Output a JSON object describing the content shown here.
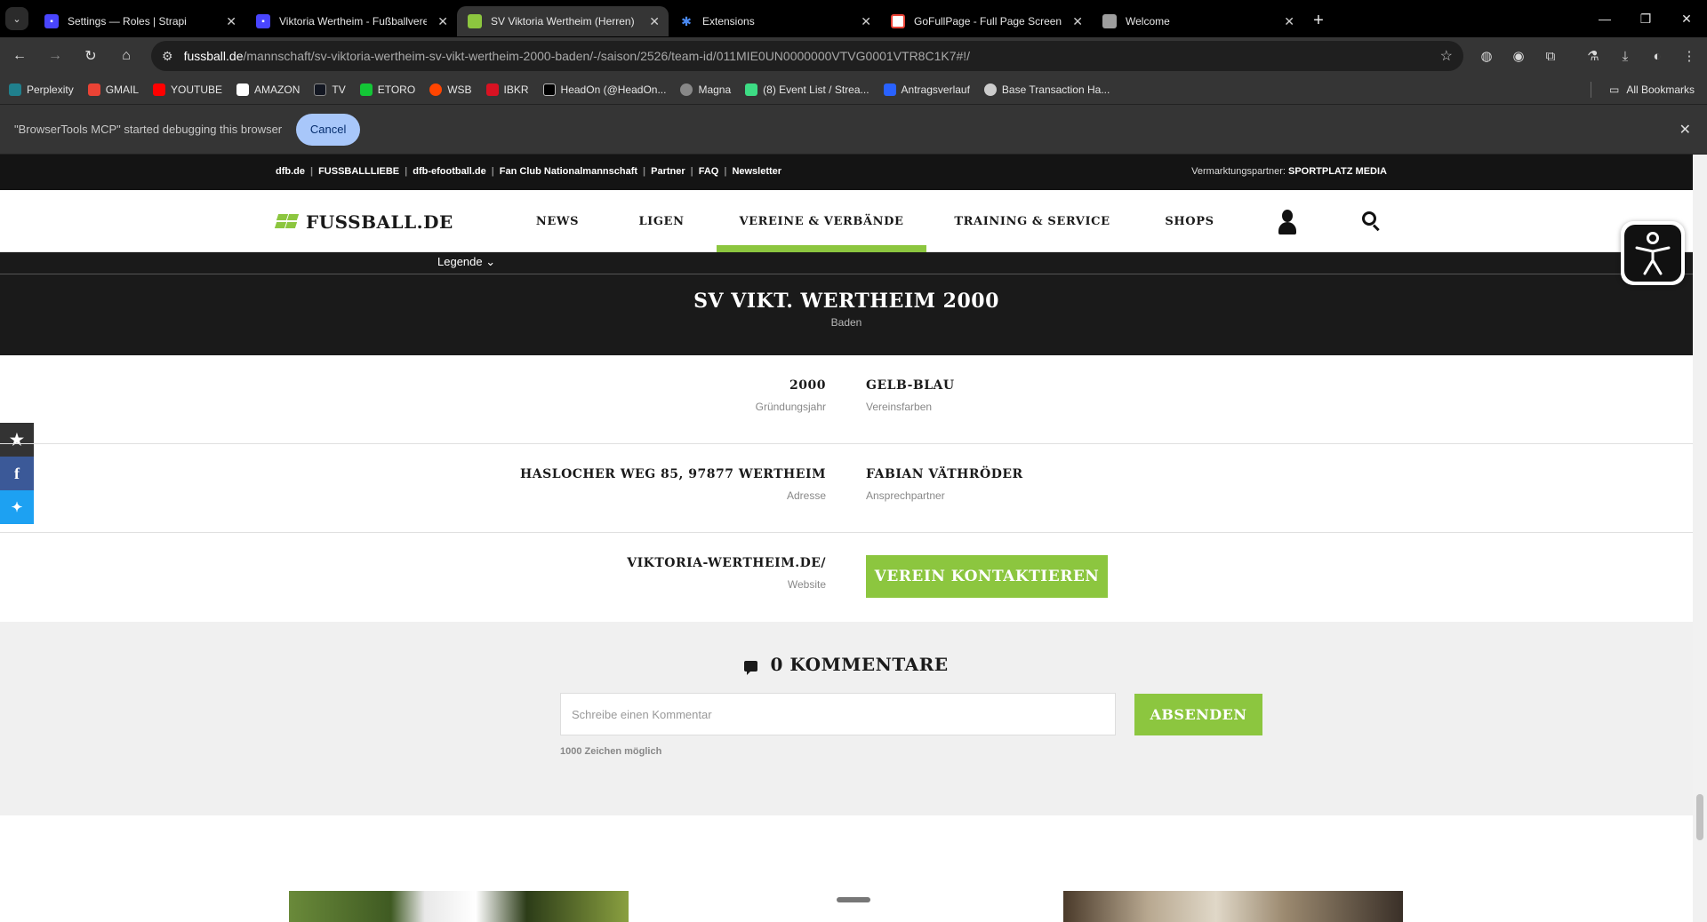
{
  "browser": {
    "tabs": [
      {
        "title": "Settings — Roles | Strapi",
        "favicon_color": "#4945ff"
      },
      {
        "title": "Viktoria Wertheim - Fußballverei",
        "favicon_color": "#4945ff"
      },
      {
        "title": "SV Viktoria Wertheim (Herren)",
        "favicon_color": "#8cc63f"
      },
      {
        "title": "Extensions",
        "favicon_color": "#4a8af4"
      },
      {
        "title": "GoFullPage - Full Page Screen C",
        "favicon_color": "#e94235"
      },
      {
        "title": "Welcome",
        "favicon_color": "#9e9e9e"
      }
    ],
    "active_tab_index": 2,
    "url_host": "fussball.de",
    "url_path": "/mannschaft/sv-viktoria-wertheim-sv-vikt-wertheim-2000-baden/-/saison/2526/team-id/011MIE0UN0000000VTVG0001VTR8C1K7#!/",
    "bookmarks": [
      {
        "label": "Perplexity",
        "color": "#20808d"
      },
      {
        "label": "GMAIL",
        "color": "#ea4335"
      },
      {
        "label": "YOUTUBE",
        "color": "#ff0000"
      },
      {
        "label": "AMAZON",
        "color": "#ffffff"
      },
      {
        "label": "TV",
        "color": "#131722"
      },
      {
        "label": "ETORO",
        "color": "#13c636"
      },
      {
        "label": "WSB",
        "color": "#ff4500"
      },
      {
        "label": "IBKR",
        "color": "#d81222"
      },
      {
        "label": "HeadOn (@HeadOn...",
        "color": "#000000"
      },
      {
        "label": "Magna",
        "color": "#888888"
      },
      {
        "label": "(8) Event List / Strea...",
        "color": "#3ddc84"
      },
      {
        "label": "Antragsverlauf",
        "color": "#2962ff"
      },
      {
        "label": "Base Transaction Ha...",
        "color": "#cccccc"
      }
    ],
    "all_bookmarks": "All Bookmarks",
    "infobar_text": "\"BrowserTools MCP\" started debugging this browser",
    "infobar_cancel": "Cancel"
  },
  "site": {
    "top_links": [
      "dfb.de",
      "FUSSBALLLIEBE",
      "dfb-efootball.de",
      "Fan Club Nationalmannschaft",
      "Partner",
      "FAQ",
      "Newsletter"
    ],
    "marketing_label": "Vermarktungspartner:",
    "marketing_partner": "SPORTPLATZ MEDIA",
    "logo": "FUSSBALL.DE",
    "menu": [
      "NEWS",
      "LIGEN",
      "VEREINE & VERBÄNDE",
      "TRAINING & SERVICE",
      "SHOPS"
    ],
    "active_menu": "VEREINE & VERBÄNDE",
    "accent_color": "#8cc63f"
  },
  "team": {
    "legende": "Legende",
    "name": "SV VIKT. WERTHEIM 2000",
    "region": "Baden"
  },
  "club_info": {
    "founded": {
      "value": "2000",
      "label": "Gründungsjahr"
    },
    "colors": {
      "value": "GELB-BLAU",
      "label": "Vereinsfarben"
    },
    "address": {
      "value": "HASLOCHER WEG 85, 97877 WERTHEIM",
      "label": "Adresse"
    },
    "contact": {
      "value": "FABIAN VÄTHRÖDER",
      "label": "Ansprechpartner"
    },
    "website": {
      "value": "VIKTORIA-WERTHEIM.DE/",
      "label": "Website"
    },
    "contact_button": "VEREIN KONTAKTIEREN"
  },
  "comments": {
    "title": "0 KOMMENTARE",
    "placeholder": "Schreibe einen Kommentar",
    "submit": "ABSENDEN",
    "hint": "1000 Zeichen möglich"
  },
  "social": [
    {
      "name": "favorite",
      "color": "#333333"
    },
    {
      "name": "facebook",
      "color": "#3b5998"
    },
    {
      "name": "twitter",
      "color": "#1da1f2"
    }
  ]
}
